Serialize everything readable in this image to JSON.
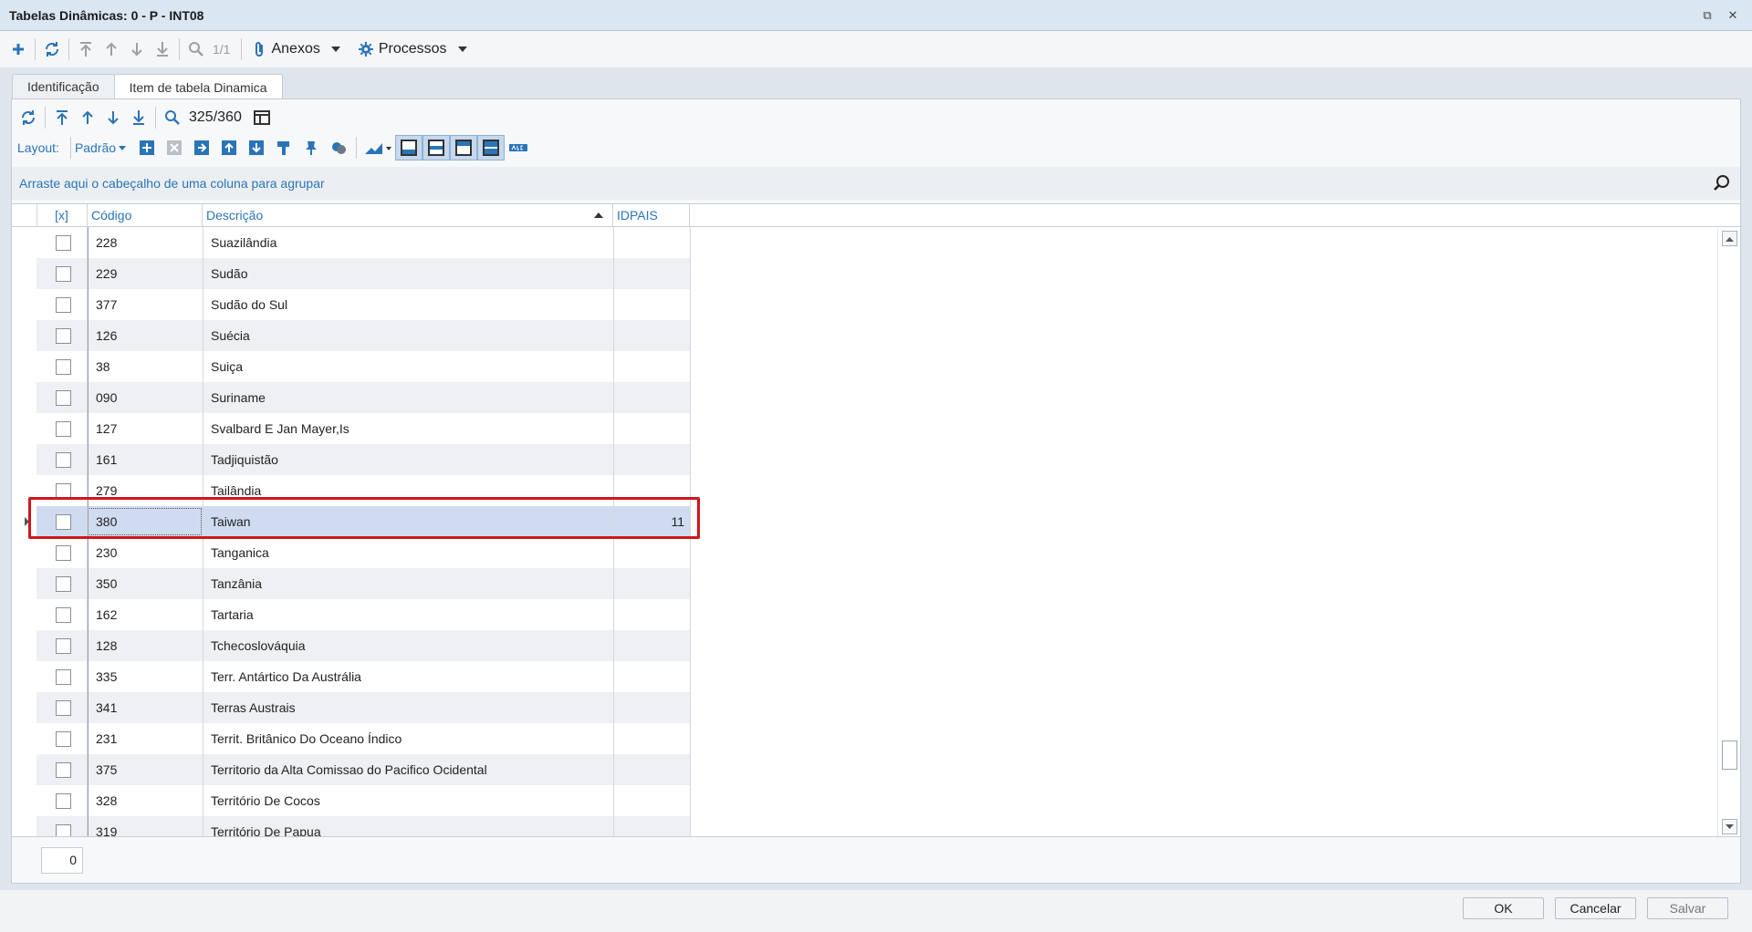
{
  "window": {
    "title": "Tabelas Dinâmicas: 0 - P - INT08"
  },
  "main_toolbar": {
    "record_counter": "1/1",
    "attachments_label": "Anexos",
    "processes_label": "Processos"
  },
  "tabs": [
    {
      "label": "Identificação"
    },
    {
      "label": "Item de tabela Dinamica"
    }
  ],
  "grid_toolbar": {
    "record_counter": "325/360",
    "layout_label": "Layout:",
    "layout_value": "Padrão"
  },
  "group_hint": "Arraste aqui o cabeçalho de uma coluna para agrupar",
  "columns": {
    "select": "[x]",
    "code": "Código",
    "description": "Descrição",
    "idpais": "IDPAIS"
  },
  "rows": [
    {
      "code": "228",
      "description": "Suazilândia",
      "idpais": ""
    },
    {
      "code": "229",
      "description": "Sudão",
      "idpais": ""
    },
    {
      "code": "377",
      "description": "Sudão do Sul",
      "idpais": ""
    },
    {
      "code": "126",
      "description": "Suécia",
      "idpais": ""
    },
    {
      "code": "38",
      "description": "Suiça",
      "idpais": ""
    },
    {
      "code": "090",
      "description": "Suriname",
      "idpais": ""
    },
    {
      "code": "127",
      "description": "Svalbard E Jan Mayer,Is",
      "idpais": ""
    },
    {
      "code": "161",
      "description": "Tadjiquistão",
      "idpais": ""
    },
    {
      "code": "279",
      "description": "Tailândia",
      "idpais": ""
    },
    {
      "code": "380",
      "description": "Taiwan",
      "idpais": "11"
    },
    {
      "code": "230",
      "description": "Tanganica",
      "idpais": ""
    },
    {
      "code": "350",
      "description": "Tanzânia",
      "idpais": ""
    },
    {
      "code": "162",
      "description": "Tartaria",
      "idpais": ""
    },
    {
      "code": "128",
      "description": "Tchecoslováquia",
      "idpais": ""
    },
    {
      "code": "335",
      "description": "Terr. Antártico Da Austrália",
      "idpais": ""
    },
    {
      "code": "341",
      "description": "Terras Austrais",
      "idpais": ""
    },
    {
      "code": "231",
      "description": "Territ. Britânico Do Oceano Índico",
      "idpais": ""
    },
    {
      "code": "375",
      "description": "Territorio da Alta Comissao do Pacifico Ocidental",
      "idpais": ""
    },
    {
      "code": "328",
      "description": "Território De Cocos",
      "idpais": ""
    },
    {
      "code": "319",
      "description": "Território De Papua",
      "idpais": ""
    }
  ],
  "selected_code": "380",
  "footer": {
    "selected_count": "0"
  },
  "buttons": {
    "ok": "OK",
    "cancel": "Cancelar",
    "save": "Salvar"
  },
  "colors": {
    "accent": "#2a74b8",
    "selection": "#cfdcf0",
    "highlight_box": "#d0161c"
  }
}
